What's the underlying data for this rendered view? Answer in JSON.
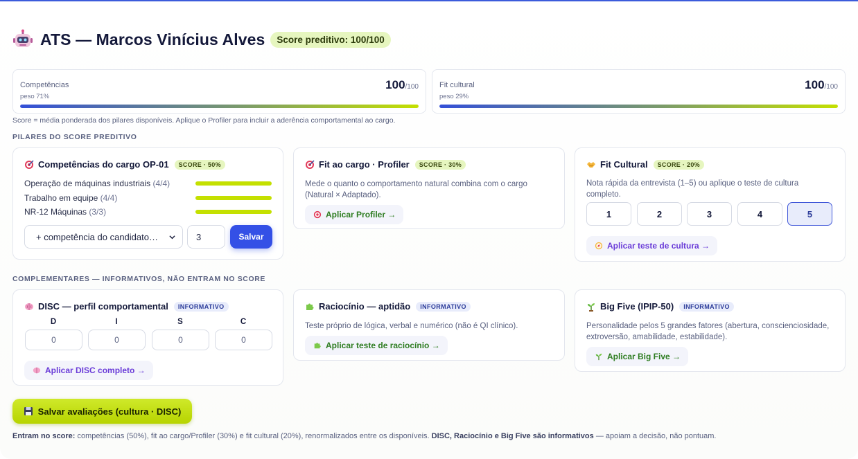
{
  "header": {
    "title": "ATS — Marcos Vinícius Alves",
    "predictive_badge": "Score preditivo: 100/100"
  },
  "kpis": [
    {
      "label": "Competências",
      "weight": "peso 71%",
      "value": "100",
      "unit": "/100",
      "fill_percent": 100
    },
    {
      "label": "Fit cultural",
      "weight": "peso 29%",
      "value": "100",
      "unit": "/100",
      "fill_percent": 100
    }
  ],
  "score_note": "Score = média ponderada dos pilares disponíveis. Aplique o Profiler para incluir a aderência comportamental ao cargo.",
  "pillars_section": "PILARES DO SCORE PREDITIVO",
  "competencias": {
    "title": "Competências do cargo OP-01",
    "tag": "SCORE · 50%",
    "items": [
      {
        "name": "Operação de máquinas industriais",
        "level": "(4/4)",
        "fill_percent": 100
      },
      {
        "name": "Trabalho em equipe",
        "level": "(4/4)",
        "fill_percent": 100
      },
      {
        "name": "NR-12 Máquinas",
        "level": "(3/3)",
        "fill_percent": 100
      }
    ],
    "select_value": "+ competência do candidato…",
    "level_value": "3",
    "save_label": "Salvar"
  },
  "fit_cargo": {
    "title": "Fit ao cargo · Profiler",
    "tag": "SCORE · 30%",
    "description": "Mede o quanto o comportamento natural combina com o cargo (Natural × Adaptado).",
    "button": "Aplicar Profiler →"
  },
  "fit_cultural": {
    "title": "Fit Cultural",
    "tag": "SCORE · 20%",
    "description": "Nota rápida da entrevista (1–5) ou aplique o teste de cultura completo.",
    "ratings": [
      "1",
      "2",
      "3",
      "4",
      "5"
    ],
    "selected": "5",
    "button": "Aplicar teste de cultura →"
  },
  "complementary_section": "COMPLEMENTARES — INFORMATIVOS, NÃO ENTRAM NO SCORE",
  "disc": {
    "title": "DISC — perfil comportamental",
    "tag": "INFORMATIVO",
    "letters": [
      "D",
      "I",
      "S",
      "C"
    ],
    "values": [
      "0",
      "0",
      "0",
      "0"
    ],
    "button": "Aplicar DISC completo →"
  },
  "raciocinio": {
    "title": "Raciocínio — aptidão",
    "tag": "INFORMATIVO",
    "description": "Teste próprio de lógica, verbal e numérico (não é QI clínico).",
    "button": "Aplicar teste de raciocínio →"
  },
  "bigfive": {
    "title": "Big Five (IPIP-50)",
    "tag": "INFORMATIVO",
    "description": "Personalidade pelos 5 grandes fatores (abertura, conscienciosidade, extroversão, amabilidade, estabilidade).",
    "button": "Aplicar Big Five →"
  },
  "save_all": "Salvar avaliações (cultura · DISC)",
  "footer": {
    "lead": "Entram no score:",
    "text": " competências (50%), fit ao cargo/Profiler (30%) e fit cultural (20%), renormalizados entre os disponíveis. ",
    "bold": "DISC, Raciocínio e Big Five são informativos",
    "tail": " — apoiam a decisão, não pontuam."
  },
  "icons": {
    "robot": "robot-icon",
    "target": "target-icon",
    "handshake": "handshake-icon",
    "compass": "compass-icon",
    "brain": "brain-icon",
    "puzzle": "puzzle-icon",
    "seedling": "seedling-icon",
    "floppy": "floppy-disk-icon"
  },
  "colors": {
    "accent": "#3450e6",
    "lime": "#c4e000",
    "badge_bg": "#e6f6bf",
    "info_bg": "#e8ecfb"
  }
}
